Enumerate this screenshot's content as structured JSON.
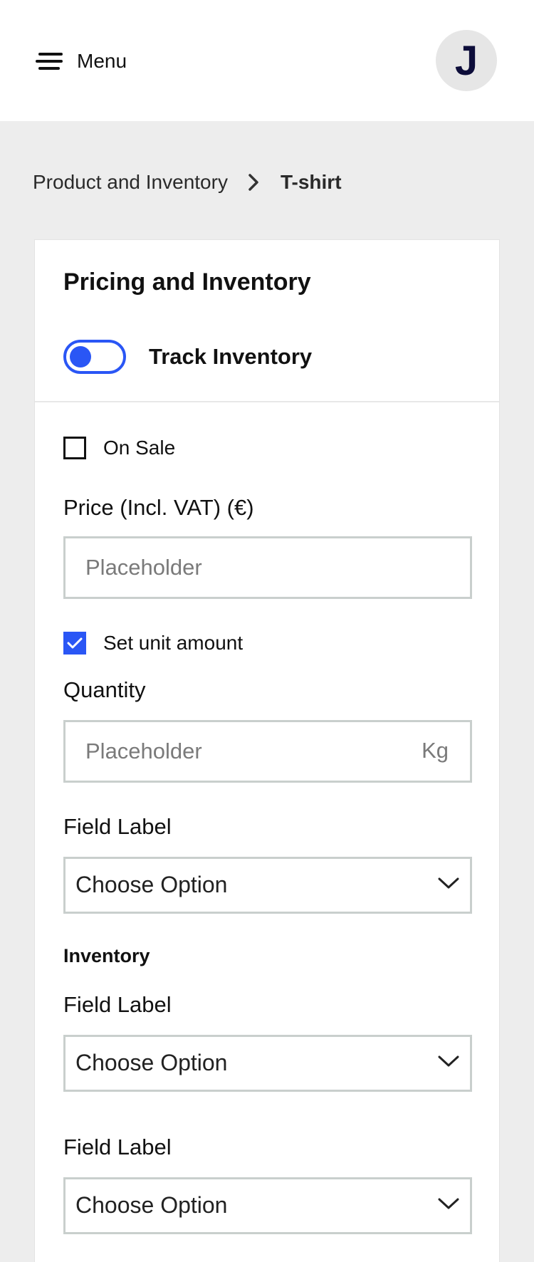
{
  "header": {
    "menu_label": "Menu",
    "menu_icon": "hamburger-icon",
    "avatar_initial": "J"
  },
  "breadcrumb": {
    "parent": "Product and Inventory",
    "separator_icon": "chevron-right-icon",
    "current": "T-shirt"
  },
  "card": {
    "title": "Pricing and Inventory",
    "track_inventory": {
      "label": "Track Inventory",
      "enabled": true
    },
    "on_sale": {
      "label": "On Sale",
      "checked": false
    },
    "price": {
      "label": "Price (Incl. VAT) (€)",
      "placeholder": "Placeholder",
      "value": ""
    },
    "set_unit_amount": {
      "label": "Set unit amount",
      "checked": true
    },
    "quantity": {
      "label": "Quantity",
      "placeholder": "Placeholder",
      "value": "",
      "suffix": "Kg"
    },
    "unit_select": {
      "label": "Field Label",
      "value": "Choose Option"
    },
    "inventory_heading": "Inventory",
    "inventory_select_1": {
      "label": "Field Label",
      "value": "Choose Option"
    },
    "inventory_select_2": {
      "label": "Field Label",
      "value": "Choose Option"
    }
  },
  "colors": {
    "accent": "#2a56f5",
    "background": "#ededed",
    "border": "#c9cfcd",
    "avatar_bg": "#e6e6e6",
    "avatar_text": "#0d0d3a"
  }
}
